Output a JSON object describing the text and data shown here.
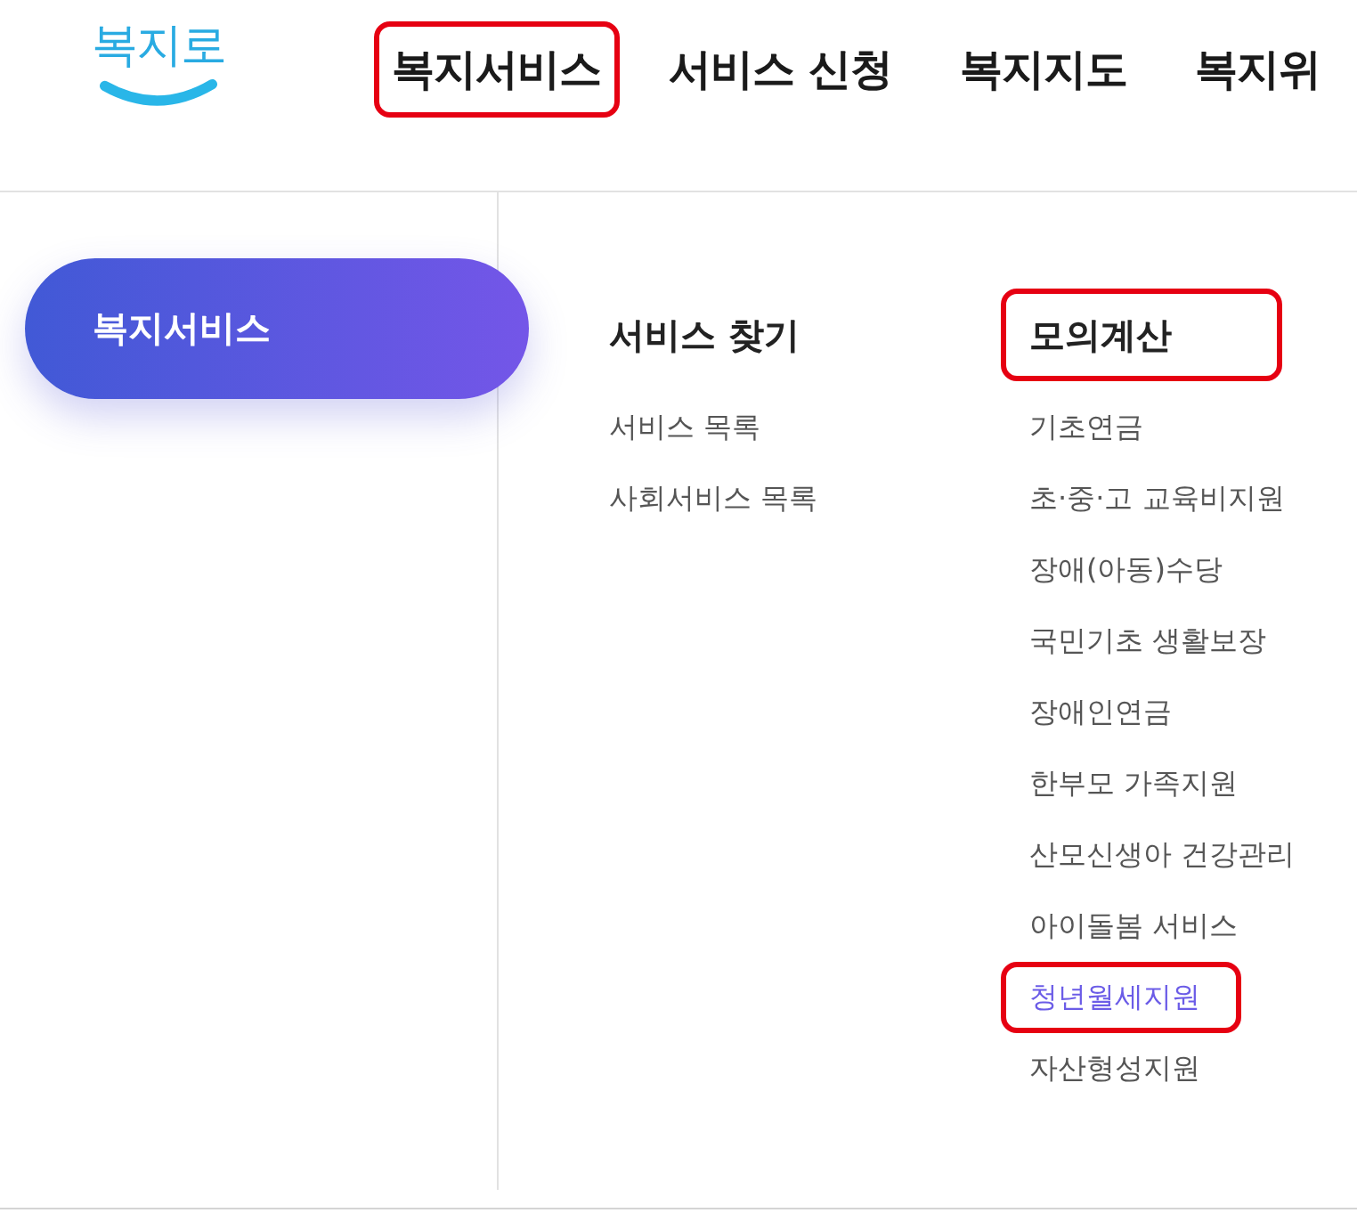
{
  "logo": {
    "text": "복지로"
  },
  "nav": [
    {
      "label": "복지서비스",
      "highlighted": true
    },
    {
      "label": "서비스 신청",
      "highlighted": false
    },
    {
      "label": "복지지도",
      "highlighted": false
    },
    {
      "label": "복지위",
      "highlighted": false
    }
  ],
  "sidebar": {
    "items": [
      {
        "label": "복지서비스",
        "selected": true
      }
    ]
  },
  "menu": {
    "columns": [
      {
        "heading": "서비스 찾기",
        "highlighted": false,
        "items": [
          {
            "label": "서비스 목록",
            "selected": false,
            "highlighted": false
          },
          {
            "label": "사회서비스 목록",
            "selected": false,
            "highlighted": false
          }
        ]
      },
      {
        "heading": "모의계산",
        "highlighted": true,
        "items": [
          {
            "label": "기초연금",
            "selected": false,
            "highlighted": false
          },
          {
            "label": "초·중·고 교육비지원",
            "selected": false,
            "highlighted": false
          },
          {
            "label": "장애(아동)수당",
            "selected": false,
            "highlighted": false
          },
          {
            "label": "국민기초 생활보장",
            "selected": false,
            "highlighted": false
          },
          {
            "label": "장애인연금",
            "selected": false,
            "highlighted": false
          },
          {
            "label": "한부모 가족지원",
            "selected": false,
            "highlighted": false
          },
          {
            "label": "산모신생아 건강관리",
            "selected": false,
            "highlighted": false
          },
          {
            "label": "아이돌봄 서비스",
            "selected": false,
            "highlighted": false
          },
          {
            "label": "청년월세지원",
            "selected": true,
            "highlighted": true
          },
          {
            "label": "자산형성지원",
            "selected": false,
            "highlighted": false
          }
        ]
      }
    ]
  }
}
